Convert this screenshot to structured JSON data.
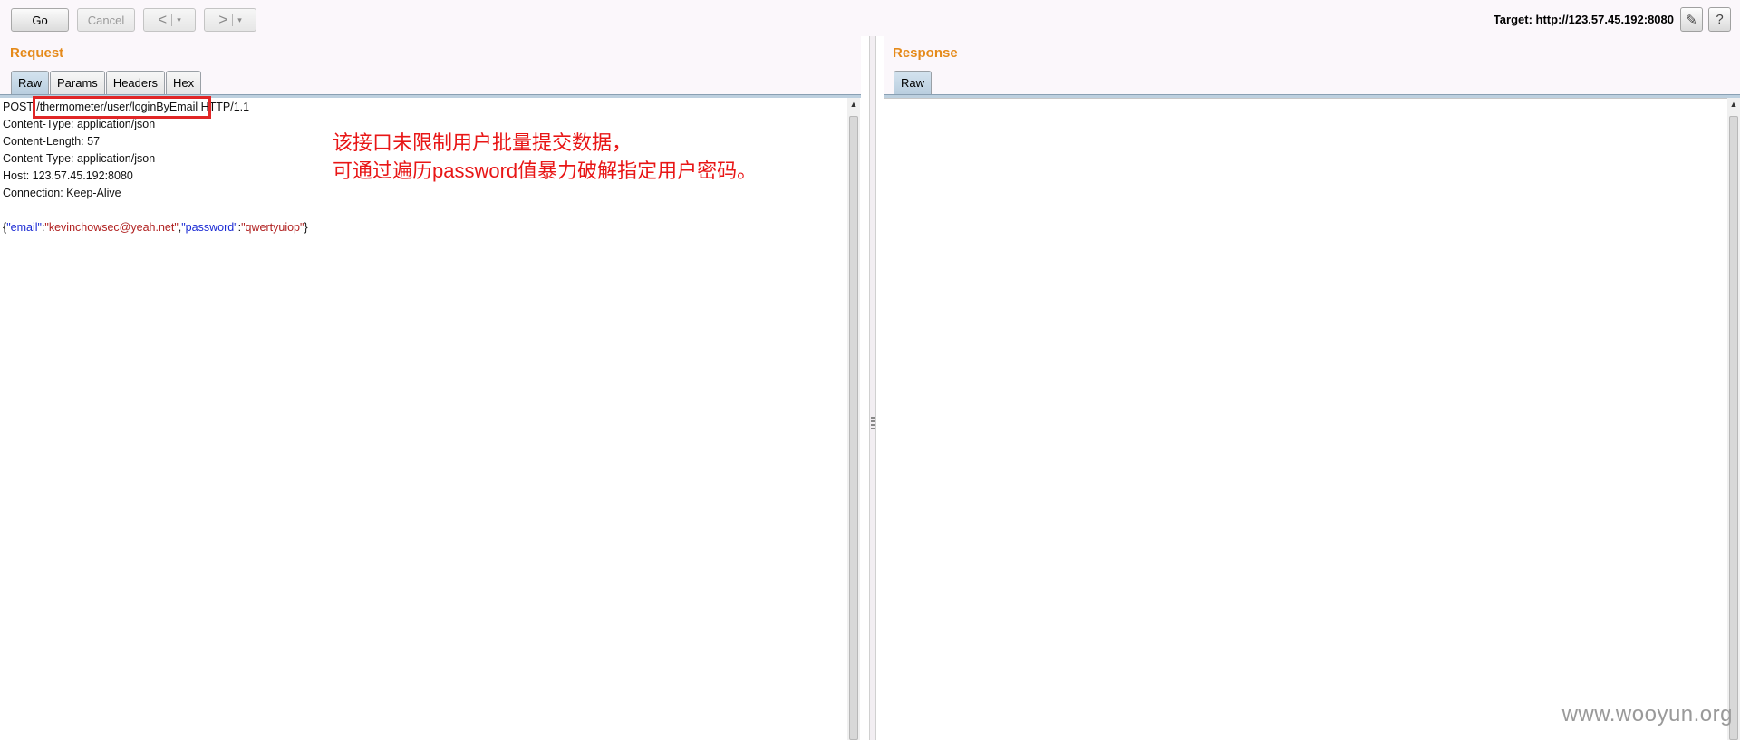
{
  "toolbar": {
    "go_label": "Go",
    "cancel_label": "Cancel",
    "back_glyph": "<",
    "forward_glyph": ">",
    "dropdown_glyph": "▾",
    "target_label": "Target: http://123.57.45.192:8080",
    "edit_icon": "pencil-icon",
    "help_icon": "help-icon",
    "edit_glyph": "✎",
    "help_glyph": "?"
  },
  "request": {
    "title": "Request",
    "tabs": [
      "Raw",
      "Params",
      "Headers",
      "Hex"
    ],
    "active_tab": "Raw",
    "method": "POST ",
    "path": "/thermometer/user/loginByEmail",
    "version": " HTTP/1.1",
    "headers": [
      "Content-Type: application/json",
      "Content-Length: 57",
      "Content-Type: application/json",
      "Host: 123.57.45.192:8080",
      "Connection: Keep-Alive"
    ],
    "body": {
      "open": "{",
      "email_key": "\"email\"",
      "colon1": ":",
      "email_value": "\"kevinchowsec@yeah.net\"",
      "comma": ",",
      "password_key": "\"password\"",
      "colon2": ":",
      "password_value": "\"qwertyuiop\"",
      "close": "}"
    }
  },
  "annotation": {
    "line1": "该接口未限制用户批量提交数据，",
    "line2": "可通过遍历password值暴力破解指定用户密码。",
    "color": "#e81616"
  },
  "response": {
    "title": "Response",
    "tabs": [
      "Raw"
    ],
    "active_tab": "Raw"
  },
  "watermark": "www.wooyun.org",
  "colors": {
    "title_orange": "#e58a1a",
    "json_key_blue": "#1b2bd4",
    "json_value_red": "#b02020",
    "highlight_red": "#e02626"
  }
}
